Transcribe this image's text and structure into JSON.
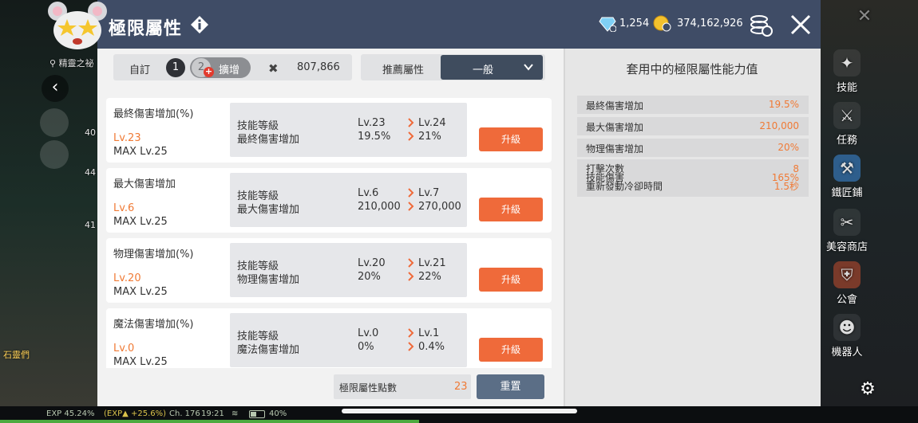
{
  "header": {
    "title": "極限屬性",
    "gems": "1,254",
    "gold": "374,162,926"
  },
  "left_hud": {
    "location": "精靈之祕",
    "char_label": "石靈們",
    "levels": [
      "40",
      "44",
      "41"
    ]
  },
  "side_menu": [
    "技能",
    "任務",
    "鐵匠鋪",
    "美容商店",
    "公會",
    "機器人"
  ],
  "toolbar": {
    "custom_label": "自訂",
    "slot1": "1",
    "slot2": "2",
    "expand_label": "擴增",
    "points": "807,866",
    "recommend_label": "推薦屬性",
    "recommend_value": "一般"
  },
  "attributes": [
    {
      "name": "最終傷害增加(%)",
      "level": "Lv.23",
      "max": "MAX Lv.25",
      "skill_label": "技能等級",
      "effect_label": "最終傷害增加",
      "cur_lv": "Lv.23",
      "cur_val": "19.5%",
      "next_lv": "Lv.24",
      "next_val": "21%",
      "button": "升級"
    },
    {
      "name": "最大傷害增加",
      "level": "Lv.6",
      "max": "MAX Lv.25",
      "skill_label": "技能等級",
      "effect_label": "最大傷害增加",
      "cur_lv": "Lv.6",
      "cur_val": "210,000",
      "next_lv": "Lv.7",
      "next_val": "270,000",
      "button": "升級"
    },
    {
      "name": "物理傷害增加(%)",
      "level": "Lv.20",
      "max": "MAX Lv.25",
      "skill_label": "技能等級",
      "effect_label": "物理傷害增加",
      "cur_lv": "Lv.20",
      "cur_val": "20%",
      "next_lv": "Lv.21",
      "next_val": "22%",
      "button": "升級"
    },
    {
      "name": "魔法傷害增加(%)",
      "level": "Lv.0",
      "max": "MAX Lv.25",
      "skill_label": "技能等級",
      "effect_label": "魔法傷害增加",
      "cur_lv": "Lv.0",
      "cur_val": "0%",
      "next_lv": "Lv.1",
      "next_val": "0.4%",
      "button": "升級"
    }
  ],
  "footer": {
    "points_label": "極限屬性點數",
    "points_value": "23",
    "reset_label": "重置"
  },
  "right_panel": {
    "title": "套用中的極限屬性能力值",
    "stats": [
      {
        "label": "最終傷害增加",
        "value": "19.5%"
      },
      {
        "label": "最大傷害增加",
        "value": "210,000"
      },
      {
        "label": "物理傷害增加",
        "value": "20%"
      }
    ],
    "multi": [
      {
        "label": "打擊次數",
        "value": "8"
      },
      {
        "label": "技能傷害",
        "value": "165%"
      },
      {
        "label": "重新發動冷卻時間",
        "value": "1.5秒"
      }
    ]
  },
  "status_bar": {
    "exp": "EXP 45.24%",
    "exp_gain": "(EXP▲ +25.6%)",
    "channel": "Ch. 176",
    "time": "19:21",
    "battery": "40%"
  },
  "colors": {
    "header": "#3f4c66",
    "accent_orange": "#ef6a3a",
    "value_orange": "#f07a35",
    "reset": "#5b6e86"
  }
}
